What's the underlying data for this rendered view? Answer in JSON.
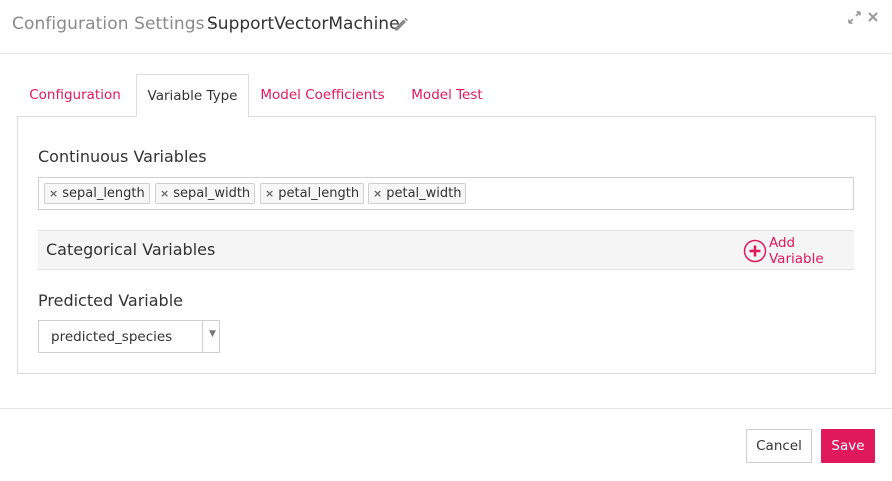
{
  "header": {
    "title_prefix": "Configuration Settings -",
    "model_name": "SupportVectorMachine"
  },
  "tabs": [
    {
      "label": "Configuration",
      "active": false
    },
    {
      "label": "Variable Type",
      "active": true
    },
    {
      "label": "Model Coefficients",
      "active": false
    },
    {
      "label": "Model Test",
      "active": false
    }
  ],
  "continuous": {
    "label": "Continuous Variables",
    "tags": [
      "sepal_length",
      "sepal_width",
      "petal_length",
      "petal_width"
    ]
  },
  "categorical": {
    "label": "Categorical Variables",
    "add_label": "Add Variable"
  },
  "predicted": {
    "label": "Predicted Variable",
    "selected": "predicted_species"
  },
  "footer": {
    "cancel_label": "Cancel",
    "save_label": "Save"
  },
  "colors": {
    "accent": "#e0195c",
    "border": "#dcdcdc",
    "muted_text": "#8a8a8a"
  },
  "icons": {
    "edit": "pencil-icon",
    "expand": "expand-icon",
    "close": "close-icon",
    "add": "plus-circle-icon",
    "tag_remove": "x-icon",
    "select": "caret-down-icon"
  }
}
